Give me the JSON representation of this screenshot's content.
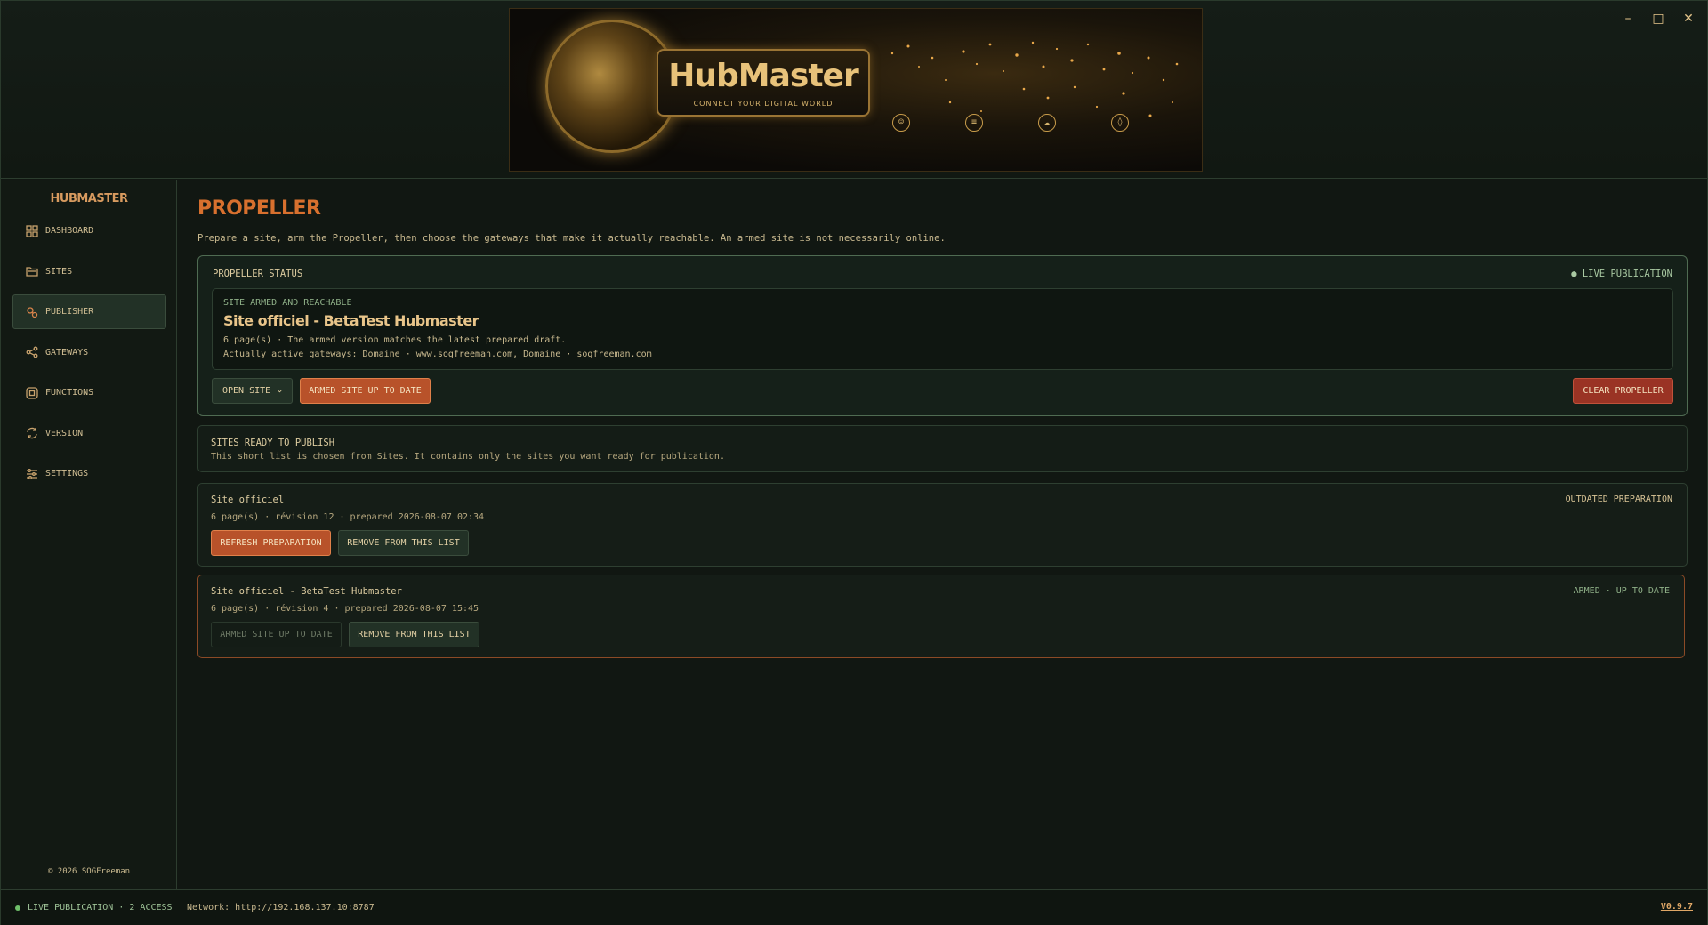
{
  "window": {
    "minimize": "–",
    "maximize": "□",
    "close": "✕"
  },
  "banner": {
    "brand": "HubMaster",
    "tagline": "CONNECT YOUR DIGITAL WORLD"
  },
  "sidebar": {
    "title": "HUBMASTER",
    "items": [
      {
        "label": "DASHBOARD",
        "icon": "dashboard-icon"
      },
      {
        "label": "SITES",
        "icon": "folder-icon"
      },
      {
        "label": "PUBLISHER",
        "icon": "rocket-icon",
        "active": true
      },
      {
        "label": "GATEWAYS",
        "icon": "share-icon"
      },
      {
        "label": "FUNCTIONS",
        "icon": "function-icon"
      },
      {
        "label": "VERSION",
        "icon": "sync-icon"
      },
      {
        "label": "SETTINGS",
        "icon": "sliders-icon"
      }
    ],
    "copyright": "© 2026 SOGFreeman"
  },
  "main": {
    "title": "PROPELLER",
    "description": "Prepare a site, arm the Propeller, then choose the gateways that make it actually reachable. An armed site is not necessarily online.",
    "status": {
      "label": "PROPELLER STATUS",
      "live": "● LIVE PUBLICATION",
      "armed_label": "SITE ARMED AND REACHABLE",
      "armed_title": "Site officiel - BetaTest Hubmaster",
      "line1": "6 page(s) · The armed version matches the latest prepared draft.",
      "line2": "Actually active gateways: Domaine · www.sogfreeman.com, Domaine · sogfreeman.com",
      "open_site": "OPEN SITE",
      "armed_btn": "ARMED SITE UP TO DATE",
      "clear_btn": "CLEAR PROPELLER"
    },
    "ready": {
      "title": "SITES READY TO PUBLISH",
      "description": "This short list is chosen from Sites. It contains only the sites you want ready for publication."
    },
    "sites": [
      {
        "name": "Site officiel",
        "meta": "6 page(s) · révision 12 · prepared 2026-08-07 02:34",
        "state": "OUTDATED PREPARATION",
        "primary": "REFRESH PREPARATION",
        "secondary": "REMOVE FROM THIS LIST"
      },
      {
        "name": "Site officiel - BetaTest Hubmaster",
        "meta": "6 page(s) · révision 4 · prepared 2026-08-07 15:45",
        "state": "ARMED · UP TO DATE",
        "primary": "ARMED SITE UP TO DATE",
        "secondary": "REMOVE FROM THIS LIST"
      }
    ]
  },
  "footer": {
    "live": "LIVE PUBLICATION · 2 ACCESS",
    "network": "Network: http://192.168.137.10:8787",
    "version": "V0.9.7"
  },
  "colors": {
    "accent": "#d8702e",
    "live": "#6fbf6a",
    "danger": "#9a3324"
  }
}
